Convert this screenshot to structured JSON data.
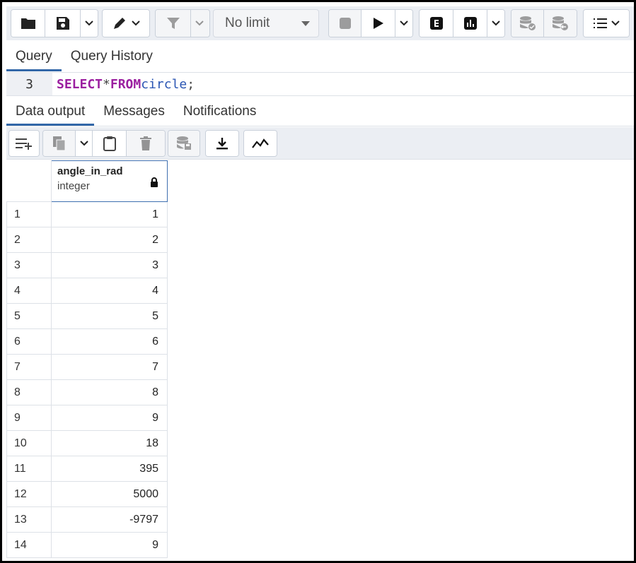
{
  "toolbar": {
    "limit_select": {
      "value": "No limit"
    }
  },
  "query_tabs": [
    {
      "label": "Query",
      "active": true
    },
    {
      "label": "Query History",
      "active": false
    }
  ],
  "editor": {
    "line_number": "3",
    "tokens": {
      "select": "SELECT",
      "star": "*",
      "from": "FROM",
      "table": "circle",
      "semicolon": ";"
    }
  },
  "output_tabs": [
    {
      "label": "Data output",
      "active": true
    },
    {
      "label": "Messages",
      "active": false
    },
    {
      "label": "Notifications",
      "active": false
    }
  ],
  "grid": {
    "column": {
      "name": "angle_in_rad",
      "type": "integer"
    },
    "rows": [
      {
        "n": "1",
        "v": "1"
      },
      {
        "n": "2",
        "v": "2"
      },
      {
        "n": "3",
        "v": "3"
      },
      {
        "n": "4",
        "v": "4"
      },
      {
        "n": "5",
        "v": "5"
      },
      {
        "n": "6",
        "v": "6"
      },
      {
        "n": "7",
        "v": "7"
      },
      {
        "n": "8",
        "v": "8"
      },
      {
        "n": "9",
        "v": "9"
      },
      {
        "n": "10",
        "v": "18"
      },
      {
        "n": "11",
        "v": "395"
      },
      {
        "n": "12",
        "v": "5000"
      },
      {
        "n": "13",
        "v": "-9797"
      },
      {
        "n": "14",
        "v": "9"
      }
    ]
  },
  "colors": {
    "accent": "#3267a8",
    "keyword": "#9b1fa0",
    "identifier": "#2a55b3",
    "toolbar_bg": "#ebeef3"
  }
}
